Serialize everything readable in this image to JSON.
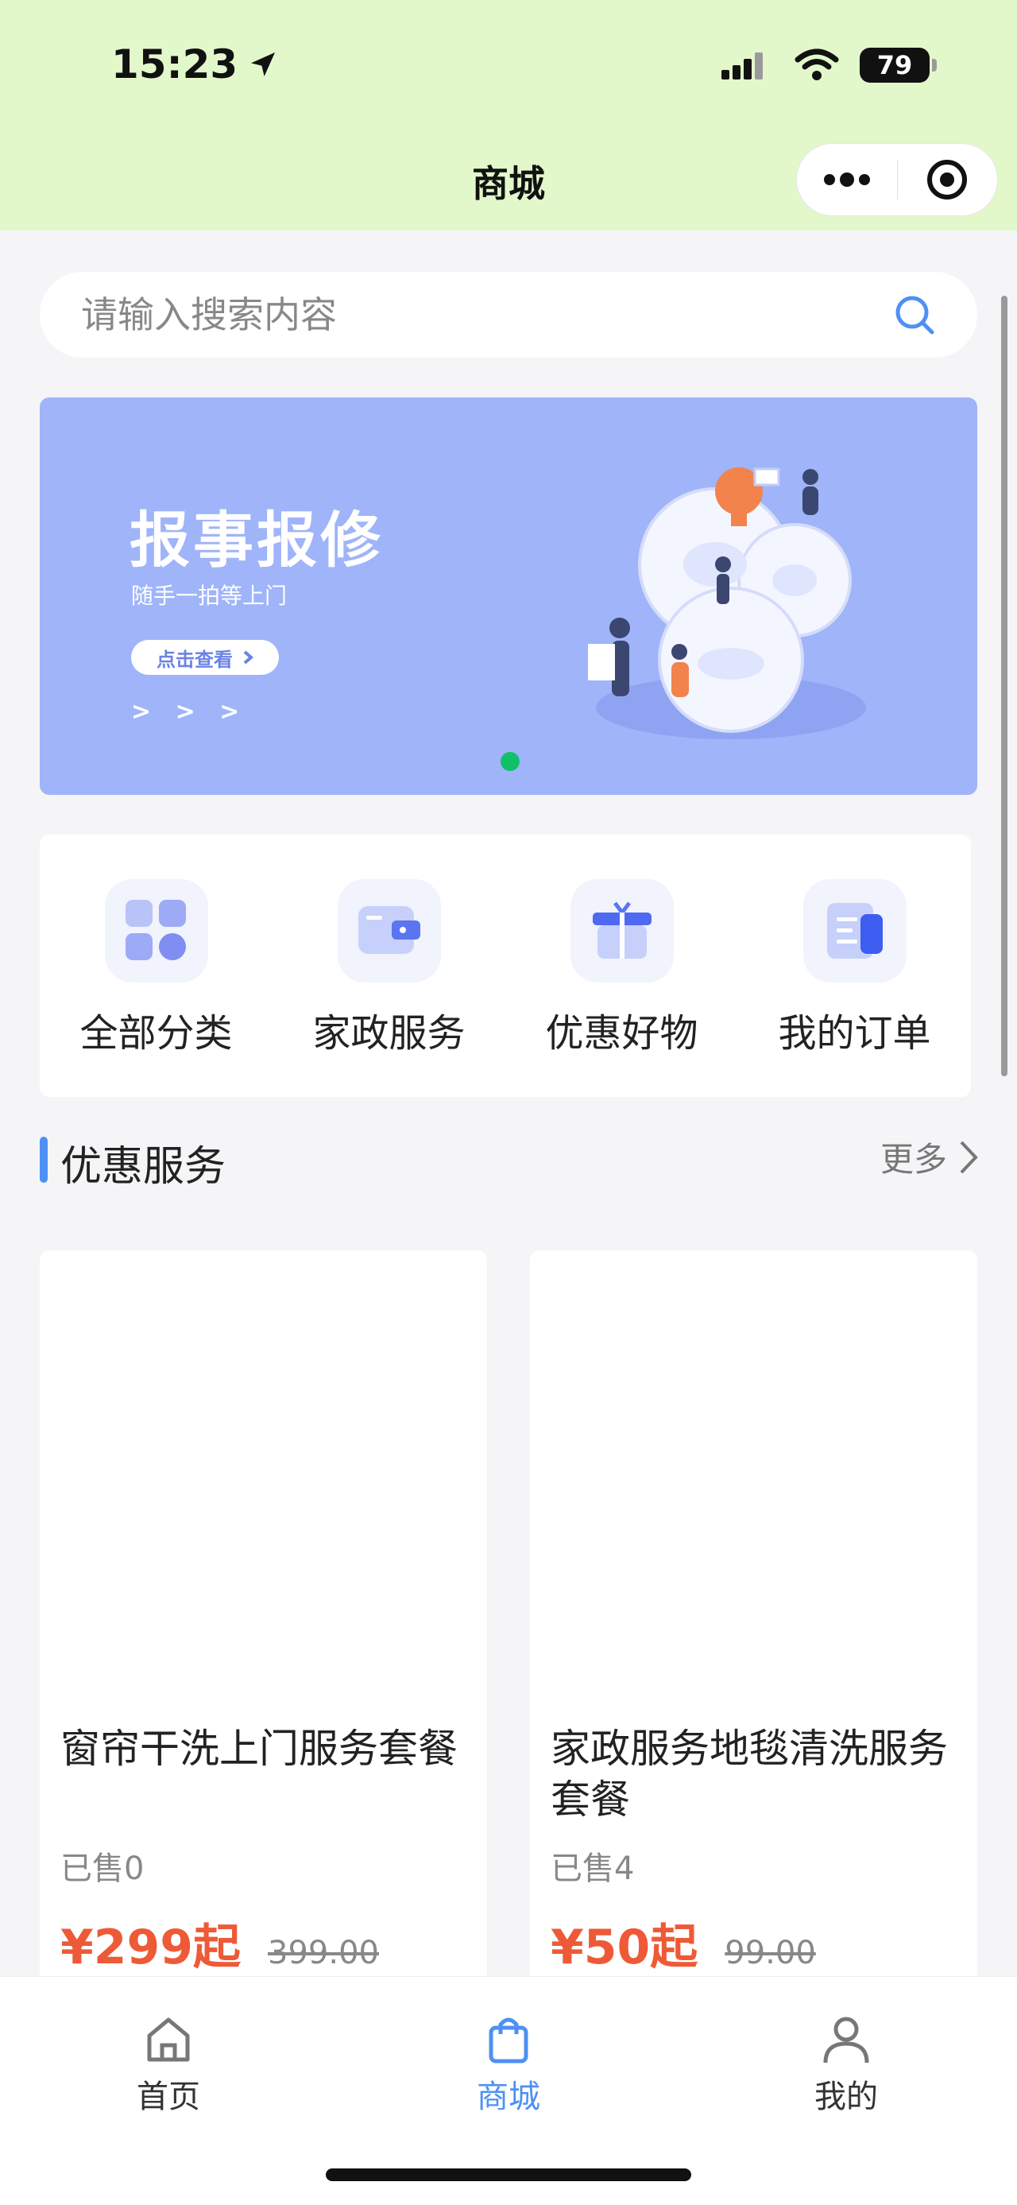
{
  "status_bar": {
    "time": "15:23",
    "battery": "79"
  },
  "header": {
    "title": "商城"
  },
  "search": {
    "placeholder": "请输入搜索内容"
  },
  "banner": {
    "title": "报事报修",
    "subtitle": "随手一拍等上门",
    "button": "点击查看",
    "arrows": "> > >"
  },
  "categories": [
    {
      "label": "全部分类",
      "icon": "grid-icon"
    },
    {
      "label": "家政服务",
      "icon": "wallet-icon"
    },
    {
      "label": "优惠好物",
      "icon": "gift-icon"
    },
    {
      "label": "我的订单",
      "icon": "order-icon"
    }
  ],
  "section": {
    "title": "优惠服务",
    "more": "更多"
  },
  "products": [
    {
      "name": "窗帘干洗上门服务套餐",
      "sold": "已售0",
      "price": "¥299起",
      "old_price": "399.00"
    },
    {
      "name": "家政服务地毯清洗服务套餐",
      "sold": "已售4",
      "price": "¥50起",
      "old_price": "99.00"
    }
  ],
  "tabbar": [
    {
      "label": "首页",
      "icon": "home-icon",
      "active": false
    },
    {
      "label": "商城",
      "icon": "shopping-bag-icon",
      "active": true
    },
    {
      "label": "我的",
      "icon": "user-icon",
      "active": false
    }
  ],
  "colors": {
    "header_bg": "#e2f8cb",
    "accent": "#4e90f4",
    "price": "#ee5a37",
    "banner_bg": "#9fb4f9"
  }
}
